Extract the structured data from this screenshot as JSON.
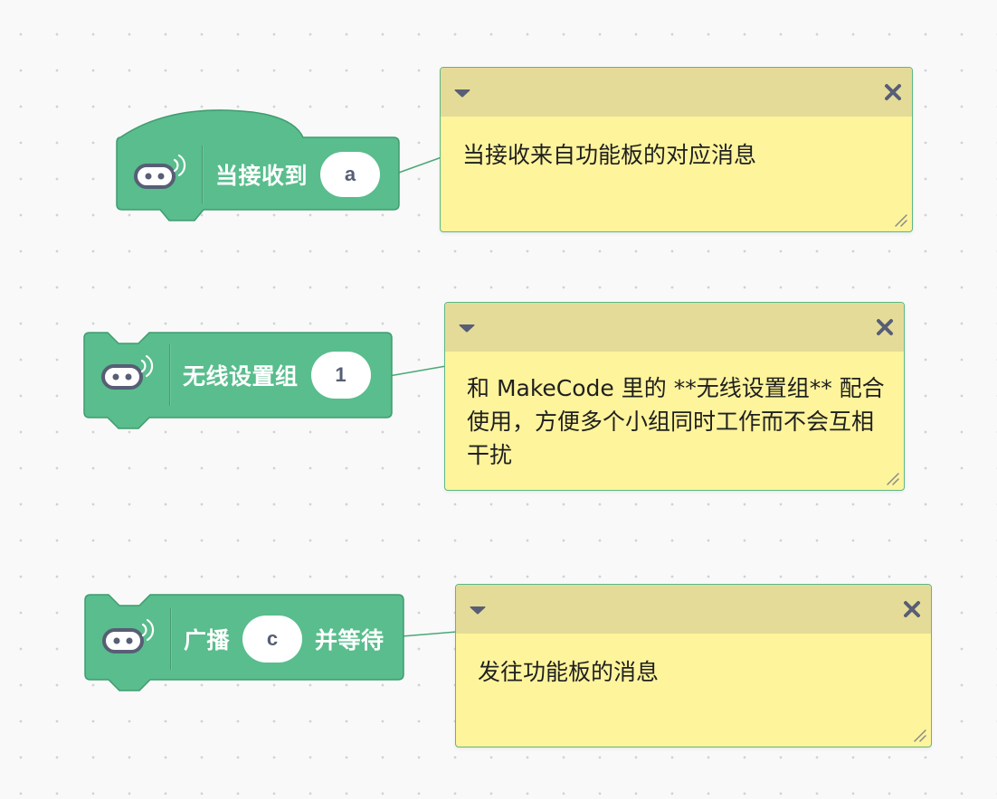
{
  "colors": {
    "block_fill": "#59bd8d",
    "block_stroke": "#3f9c6e",
    "note_fill": "#fef49c",
    "note_header": "#e5db98",
    "note_border": "#5cb884",
    "pill_text": "#575e75",
    "icon_color": "#575e75"
  },
  "blocks": [
    {
      "kind": "hat",
      "label": "当接收到",
      "input_value": "a",
      "icon": "robot-radio-icon",
      "comment": "当接收来自功能板的对应消息"
    },
    {
      "kind": "stack",
      "label": "无线设置组",
      "input_value": "1",
      "icon": "robot-radio-icon",
      "comment": "和 MakeCode 里的 **无线设置组** 配合使用，方便多个小组同时工作而不会互相干扰"
    },
    {
      "kind": "stack",
      "label": "广播",
      "input_value": "c",
      "suffix_label": "并等待",
      "icon": "robot-radio-icon",
      "comment": "发往功能板的消息"
    }
  ],
  "note_controls": {
    "toggle_icon": "caret-down-icon",
    "close_icon": "close-x-icon",
    "resize_icon": "resize-grip-icon"
  }
}
